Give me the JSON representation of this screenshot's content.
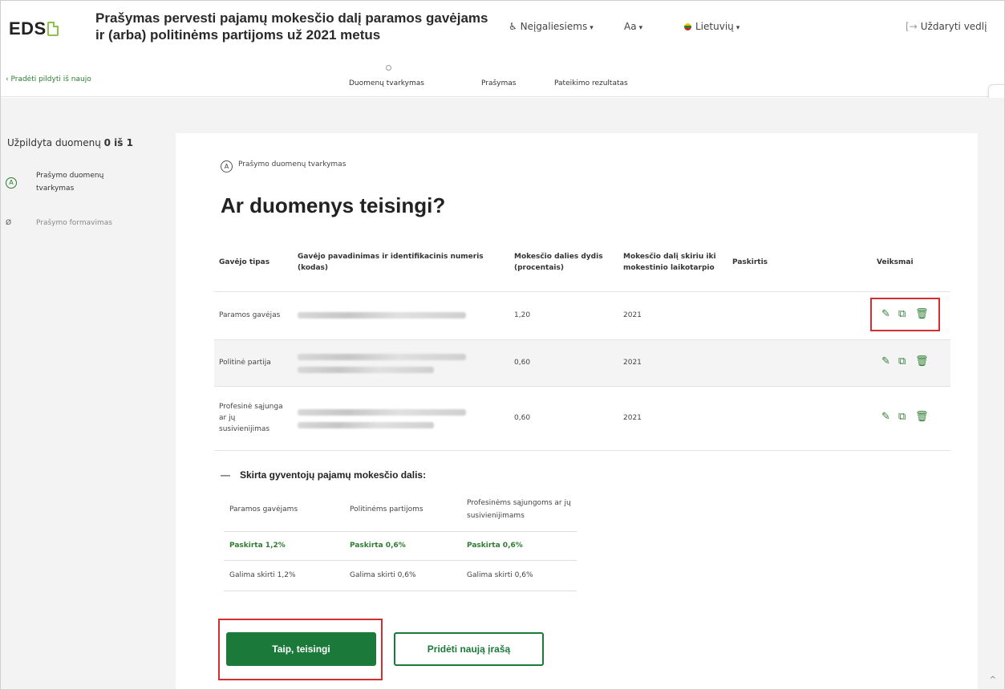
{
  "header": {
    "logo": "EDS",
    "title_line1": "Prašymas pervesti pajamų mokesčio dalį paramos gavėjams",
    "title_line2": "ir (arba) politinėms partijoms už 2021 metus",
    "accessible_label": "Neįgaliesiems",
    "accessible_icon": "wheelchair-icon",
    "fontsize_label": "Aa",
    "language_label": "Lietuvių",
    "close_label": "Uždaryti vedlį",
    "close_icon": "exit-icon"
  },
  "steps": {
    "restart_label": "Pradėti pildyti iš naujo",
    "items": [
      "Duomenų tvarkymas",
      "Prašymas",
      "Pateikimo rezultatas"
    ]
  },
  "sidebar": {
    "progress_prefix": "Užpildyta duomenų",
    "progress_value": "0 iš 1",
    "items": [
      {
        "mark": "A",
        "label": "Prašymo duomenų tvarkymas"
      },
      {
        "mark": "Ø",
        "label": "Prašymo formavimas"
      }
    ]
  },
  "main": {
    "crumb_mark": "A",
    "crumb_label": "Prašymo duomenų tvarkymas",
    "heading": "Ar duomenys teisingi?",
    "table": {
      "headers": [
        "Gavėjo tipas",
        "Gavėjo pavadinimas ir identifikacinis numeris (kodas)",
        "Mokesčio dalies dydis (procentais)",
        "Mokesčio dalį skiriu iki mokestinio laikotarpio",
        "Paskirtis",
        "Veiksmai"
      ],
      "rows": [
        {
          "type": "Paramos gavėjas",
          "percent": "1,20",
          "period": "2021",
          "purpose": ""
        },
        {
          "type": "Politinė partija",
          "percent": "0,60",
          "period": "2021",
          "purpose": ""
        },
        {
          "type": "Profesinė sąjunga ar jų susivienijimas",
          "percent": "0,60",
          "period": "2021",
          "purpose": ""
        }
      ],
      "action_icons": [
        "pencil-icon",
        "copy-icon",
        "trash-icon"
      ]
    },
    "allocation": {
      "title": "Skirta gyventojų pajamų mokesčio dalis:",
      "collapse_symbol": "—",
      "headers": [
        "Paramos gavėjams",
        "Politinėms partijoms",
        "Profesinėms sąjungoms ar jų susivienijimams"
      ],
      "assigned": [
        "Paskirta 1,2%",
        "Paskirta 0,6%",
        "Paskirta 0,6%"
      ],
      "available": [
        "Galima skirti 1,2%",
        "Galima skirti 0,6%",
        "Galima skirti 0,6%"
      ]
    },
    "buttons": {
      "confirm": "Taip, teisingi",
      "add": "Pridėti naują įrašą"
    }
  },
  "colors": {
    "brand_green": "#1b7a3a",
    "highlight_red": "#d32f2f",
    "backdrop_gray": "#f3f3f3"
  }
}
